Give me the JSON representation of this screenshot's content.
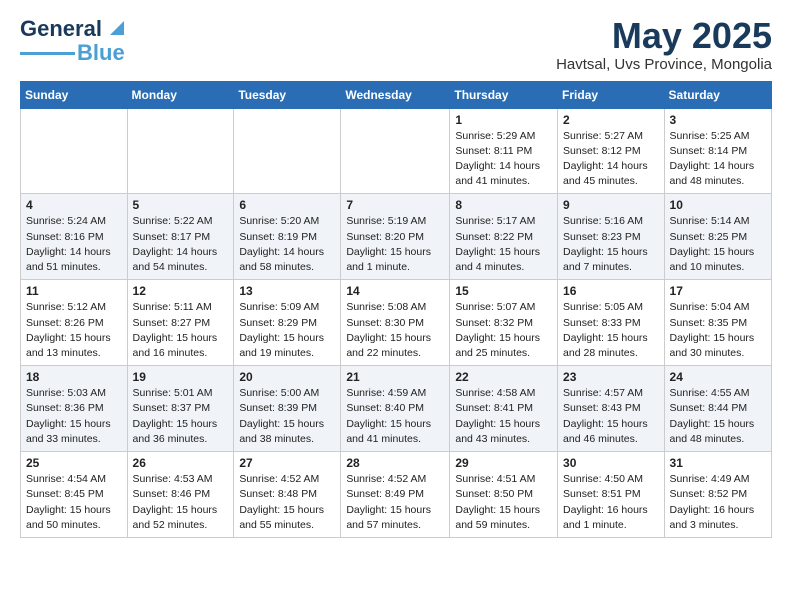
{
  "header": {
    "logo_general": "General",
    "logo_blue": "Blue",
    "month_title": "May 2025",
    "location": "Havtsal, Uvs Province, Mongolia"
  },
  "weekdays": [
    "Sunday",
    "Monday",
    "Tuesday",
    "Wednesday",
    "Thursday",
    "Friday",
    "Saturday"
  ],
  "weeks": [
    [
      {
        "day": "",
        "info": ""
      },
      {
        "day": "",
        "info": ""
      },
      {
        "day": "",
        "info": ""
      },
      {
        "day": "",
        "info": ""
      },
      {
        "day": "1",
        "info": "Sunrise: 5:29 AM\nSunset: 8:11 PM\nDaylight: 14 hours\nand 41 minutes."
      },
      {
        "day": "2",
        "info": "Sunrise: 5:27 AM\nSunset: 8:12 PM\nDaylight: 14 hours\nand 45 minutes."
      },
      {
        "day": "3",
        "info": "Sunrise: 5:25 AM\nSunset: 8:14 PM\nDaylight: 14 hours\nand 48 minutes."
      }
    ],
    [
      {
        "day": "4",
        "info": "Sunrise: 5:24 AM\nSunset: 8:16 PM\nDaylight: 14 hours\nand 51 minutes."
      },
      {
        "day": "5",
        "info": "Sunrise: 5:22 AM\nSunset: 8:17 PM\nDaylight: 14 hours\nand 54 minutes."
      },
      {
        "day": "6",
        "info": "Sunrise: 5:20 AM\nSunset: 8:19 PM\nDaylight: 14 hours\nand 58 minutes."
      },
      {
        "day": "7",
        "info": "Sunrise: 5:19 AM\nSunset: 8:20 PM\nDaylight: 15 hours\nand 1 minute."
      },
      {
        "day": "8",
        "info": "Sunrise: 5:17 AM\nSunset: 8:22 PM\nDaylight: 15 hours\nand 4 minutes."
      },
      {
        "day": "9",
        "info": "Sunrise: 5:16 AM\nSunset: 8:23 PM\nDaylight: 15 hours\nand 7 minutes."
      },
      {
        "day": "10",
        "info": "Sunrise: 5:14 AM\nSunset: 8:25 PM\nDaylight: 15 hours\nand 10 minutes."
      }
    ],
    [
      {
        "day": "11",
        "info": "Sunrise: 5:12 AM\nSunset: 8:26 PM\nDaylight: 15 hours\nand 13 minutes."
      },
      {
        "day": "12",
        "info": "Sunrise: 5:11 AM\nSunset: 8:27 PM\nDaylight: 15 hours\nand 16 minutes."
      },
      {
        "day": "13",
        "info": "Sunrise: 5:09 AM\nSunset: 8:29 PM\nDaylight: 15 hours\nand 19 minutes."
      },
      {
        "day": "14",
        "info": "Sunrise: 5:08 AM\nSunset: 8:30 PM\nDaylight: 15 hours\nand 22 minutes."
      },
      {
        "day": "15",
        "info": "Sunrise: 5:07 AM\nSunset: 8:32 PM\nDaylight: 15 hours\nand 25 minutes."
      },
      {
        "day": "16",
        "info": "Sunrise: 5:05 AM\nSunset: 8:33 PM\nDaylight: 15 hours\nand 28 minutes."
      },
      {
        "day": "17",
        "info": "Sunrise: 5:04 AM\nSunset: 8:35 PM\nDaylight: 15 hours\nand 30 minutes."
      }
    ],
    [
      {
        "day": "18",
        "info": "Sunrise: 5:03 AM\nSunset: 8:36 PM\nDaylight: 15 hours\nand 33 minutes."
      },
      {
        "day": "19",
        "info": "Sunrise: 5:01 AM\nSunset: 8:37 PM\nDaylight: 15 hours\nand 36 minutes."
      },
      {
        "day": "20",
        "info": "Sunrise: 5:00 AM\nSunset: 8:39 PM\nDaylight: 15 hours\nand 38 minutes."
      },
      {
        "day": "21",
        "info": "Sunrise: 4:59 AM\nSunset: 8:40 PM\nDaylight: 15 hours\nand 41 minutes."
      },
      {
        "day": "22",
        "info": "Sunrise: 4:58 AM\nSunset: 8:41 PM\nDaylight: 15 hours\nand 43 minutes."
      },
      {
        "day": "23",
        "info": "Sunrise: 4:57 AM\nSunset: 8:43 PM\nDaylight: 15 hours\nand 46 minutes."
      },
      {
        "day": "24",
        "info": "Sunrise: 4:55 AM\nSunset: 8:44 PM\nDaylight: 15 hours\nand 48 minutes."
      }
    ],
    [
      {
        "day": "25",
        "info": "Sunrise: 4:54 AM\nSunset: 8:45 PM\nDaylight: 15 hours\nand 50 minutes."
      },
      {
        "day": "26",
        "info": "Sunrise: 4:53 AM\nSunset: 8:46 PM\nDaylight: 15 hours\nand 52 minutes."
      },
      {
        "day": "27",
        "info": "Sunrise: 4:52 AM\nSunset: 8:48 PM\nDaylight: 15 hours\nand 55 minutes."
      },
      {
        "day": "28",
        "info": "Sunrise: 4:52 AM\nSunset: 8:49 PM\nDaylight: 15 hours\nand 57 minutes."
      },
      {
        "day": "29",
        "info": "Sunrise: 4:51 AM\nSunset: 8:50 PM\nDaylight: 15 hours\nand 59 minutes."
      },
      {
        "day": "30",
        "info": "Sunrise: 4:50 AM\nSunset: 8:51 PM\nDaylight: 16 hours\nand 1 minute."
      },
      {
        "day": "31",
        "info": "Sunrise: 4:49 AM\nSunset: 8:52 PM\nDaylight: 16 hours\nand 3 minutes."
      }
    ]
  ]
}
